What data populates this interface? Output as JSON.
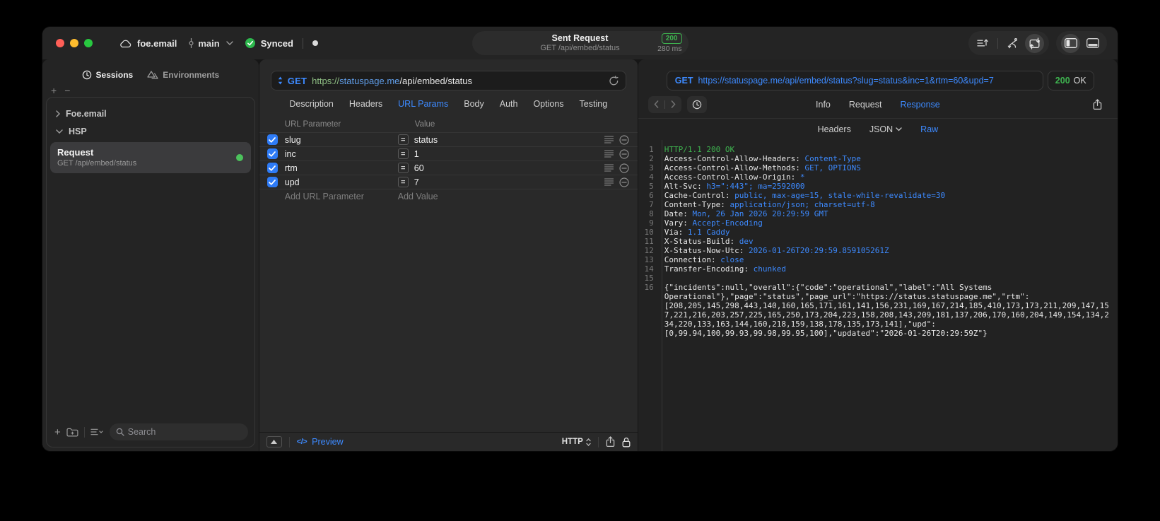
{
  "titlebar": {
    "project": "foe.email",
    "branch": "main",
    "sync_status": "Synced",
    "request_title": "Sent Request",
    "request_subtitle": "GET /api/embed/status",
    "status_code": "200",
    "duration": "280 ms"
  },
  "sidebar": {
    "tabs": [
      {
        "label": "Sessions",
        "active": true
      },
      {
        "label": "Environments",
        "active": false
      }
    ],
    "add_label": "+",
    "remove_label": "−",
    "groups": [
      {
        "label": "Foe.email",
        "expanded": false
      },
      {
        "label": "HSP",
        "expanded": true
      }
    ],
    "request_item": {
      "title": "Request",
      "subtitle": "GET /api/embed/status",
      "active": true
    },
    "search_placeholder": "Search"
  },
  "request_pane": {
    "method": "GET",
    "url": {
      "scheme": "https://",
      "host": "statuspage.me",
      "path": "/api/embed/status"
    },
    "tabs": [
      {
        "label": "Description",
        "active": false
      },
      {
        "label": "Headers",
        "active": false
      },
      {
        "label": "URL Params",
        "active": true
      },
      {
        "label": "Body",
        "active": false
      },
      {
        "label": "Auth",
        "active": false
      },
      {
        "label": "Options",
        "active": false
      },
      {
        "label": "Testing",
        "active": false
      }
    ],
    "params_table": {
      "columns": [
        "URL Parameter",
        "Value"
      ],
      "equals_glyph": "=",
      "rows": [
        {
          "name": "slug",
          "value": "status",
          "checked": true
        },
        {
          "name": "inc",
          "value": "1",
          "checked": true
        },
        {
          "name": "rtm",
          "value": "60",
          "checked": true
        },
        {
          "name": "upd",
          "value": "7",
          "checked": true
        }
      ],
      "add_param_placeholder": "Add URL Parameter",
      "add_value_placeholder": "Add Value"
    },
    "footer": {
      "code_glyph": "</>",
      "preview_label": "Preview",
      "protocol": "HTTP"
    }
  },
  "response_pane": {
    "method": "GET",
    "url": "https://statuspage.me/api/embed/status?slug=status&inc=1&rtm=60&upd=7",
    "status_code": "200",
    "status_text": "OK",
    "tabs": [
      {
        "label": "Info",
        "active": false
      },
      {
        "label": "Request",
        "active": false
      },
      {
        "label": "Response",
        "active": true
      }
    ],
    "view_tabs": [
      {
        "label": "Headers",
        "active": false,
        "dropdown": false
      },
      {
        "label": "JSON",
        "active": false,
        "dropdown": true
      },
      {
        "label": "Raw",
        "active": true,
        "dropdown": false
      }
    ],
    "lines": [
      {
        "n": "1",
        "parts": [
          {
            "t": "HTTP/1.1 200 OK",
            "c": "status"
          }
        ]
      },
      {
        "n": "2",
        "parts": [
          {
            "t": "Access-Control-Allow-Headers: ",
            "c": "plain"
          },
          {
            "t": "Content-Type",
            "c": "value"
          }
        ]
      },
      {
        "n": "3",
        "parts": [
          {
            "t": "Access-Control-Allow-Methods: ",
            "c": "plain"
          },
          {
            "t": "GET, OPTIONS",
            "c": "value"
          }
        ]
      },
      {
        "n": "4",
        "parts": [
          {
            "t": "Access-Control-Allow-Origin: ",
            "c": "plain"
          },
          {
            "t": "*",
            "c": "value"
          }
        ]
      },
      {
        "n": "5",
        "parts": [
          {
            "t": "Alt-Svc: ",
            "c": "plain"
          },
          {
            "t": "h3=\":443\"; ma=2592000",
            "c": "value"
          }
        ]
      },
      {
        "n": "6",
        "parts": [
          {
            "t": "Cache-Control: ",
            "c": "plain"
          },
          {
            "t": "public, max-age=15, stale-while-revalidate=30",
            "c": "value"
          }
        ]
      },
      {
        "n": "7",
        "parts": [
          {
            "t": "Content-Type: ",
            "c": "plain"
          },
          {
            "t": "application/json; charset=utf-8",
            "c": "value"
          }
        ]
      },
      {
        "n": "8",
        "parts": [
          {
            "t": "Date: ",
            "c": "plain"
          },
          {
            "t": "Mon, 26 Jan 2026 20:29:59 GMT",
            "c": "value"
          }
        ]
      },
      {
        "n": "9",
        "parts": [
          {
            "t": "Vary: ",
            "c": "plain"
          },
          {
            "t": "Accept-Encoding",
            "c": "value"
          }
        ]
      },
      {
        "n": "10",
        "parts": [
          {
            "t": "Via: ",
            "c": "plain"
          },
          {
            "t": "1.1 Caddy",
            "c": "value"
          }
        ]
      },
      {
        "n": "11",
        "parts": [
          {
            "t": "X-Status-Build: ",
            "c": "plain"
          },
          {
            "t": "dev",
            "c": "value"
          }
        ]
      },
      {
        "n": "12",
        "parts": [
          {
            "t": "X-Status-Now-Utc: ",
            "c": "plain"
          },
          {
            "t": "2026-01-26T20:29:59.859105261Z",
            "c": "value"
          }
        ]
      },
      {
        "n": "13",
        "parts": [
          {
            "t": "Connection: ",
            "c": "plain"
          },
          {
            "t": "close",
            "c": "value"
          }
        ]
      },
      {
        "n": "14",
        "parts": [
          {
            "t": "Transfer-Encoding: ",
            "c": "plain"
          },
          {
            "t": "chunked",
            "c": "value"
          }
        ]
      },
      {
        "n": "15",
        "parts": []
      },
      {
        "n": "16",
        "parts": [
          {
            "t": "{\"incidents\":null,\"overall\":{\"code\":\"operational\",\"label\":\"All Systems Operational\"},\"page\":\"status\",\"page_url\":\"https://status.statuspage.me\",\"rtm\":[208,205,145,298,443,140,160,165,171,161,141,156,231,169,167,214,185,410,173,173,211,209,147,157,221,216,203,257,225,165,250,173,204,223,158,208,143,209,181,137,206,170,160,204,149,154,134,234,220,133,163,144,160,218,159,138,178,135,173,141],\"upd\":[0,99.94,100,99.93,99.98,99.95,100],\"updated\":\"2026-01-26T20:29:59Z\"}",
            "c": "plain"
          }
        ]
      }
    ]
  },
  "colors": {
    "accent_blue": "#3d8aff",
    "status_green": "#3eb34f",
    "url_scheme_green": "#8fbf84",
    "url_host_blue": "#5f9ce6",
    "checkbox_blue": "#2e7bf6",
    "traffic_red": "#ff5f57",
    "traffic_yellow": "#febc2e",
    "traffic_green": "#28c840",
    "request_dot_green": "#4cc25c"
  }
}
